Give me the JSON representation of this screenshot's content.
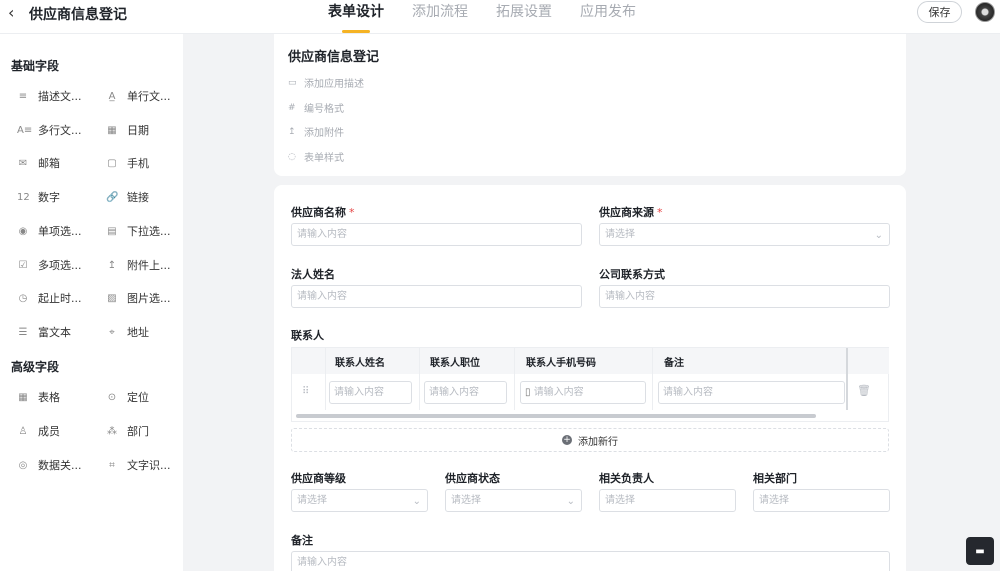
{
  "header": {
    "back_icon": "chevron-left-icon",
    "title": "供应商信息登记",
    "tabs": [
      "表单设计",
      "添加流程",
      "拓展设置",
      "应用发布"
    ],
    "active_tab": 0,
    "save_label": "保存"
  },
  "sidebar": {
    "basic_title": "基础字段",
    "basic_fields": [
      {
        "label": "描述文...",
        "icon": "≡"
      },
      {
        "label": "单行文...",
        "icon": "A̲"
      },
      {
        "label": "多行文...",
        "icon": "A≡"
      },
      {
        "label": "日期",
        "icon": "▦"
      },
      {
        "label": "邮箱",
        "icon": "✉"
      },
      {
        "label": "手机",
        "icon": "▢"
      },
      {
        "label": "数字",
        "icon": "12"
      },
      {
        "label": "链接",
        "icon": "🔗"
      },
      {
        "label": "单项选...",
        "icon": "◉"
      },
      {
        "label": "下拉选...",
        "icon": "▤"
      },
      {
        "label": "多项选...",
        "icon": "☑"
      },
      {
        "label": "附件上...",
        "icon": "↥"
      },
      {
        "label": "起止时...",
        "icon": "◷"
      },
      {
        "label": "图片选...",
        "icon": "▨"
      },
      {
        "label": "富文本",
        "icon": "☰"
      },
      {
        "label": "地址",
        "icon": "⌖"
      }
    ],
    "advanced_title": "高级字段",
    "advanced_fields": [
      {
        "label": "表格",
        "icon": "▦"
      },
      {
        "label": "定位",
        "icon": "⊙"
      },
      {
        "label": "成员",
        "icon": "♙"
      },
      {
        "label": "部门",
        "icon": "⁂"
      },
      {
        "label": "数据关...",
        "icon": "◎"
      },
      {
        "label": "文字识...",
        "icon": "⌗"
      }
    ]
  },
  "form_header": {
    "title": "供应商信息登记",
    "meta": [
      {
        "label": "添加应用描述",
        "icon": "▭"
      },
      {
        "label": "编号格式",
        "icon": "#"
      },
      {
        "label": "添加附件",
        "icon": "↥"
      },
      {
        "label": "表单样式",
        "icon": "◌"
      }
    ]
  },
  "form": {
    "supplier_name": {
      "label": "供应商名称",
      "placeholder": "请输入内容"
    },
    "supplier_source": {
      "label": "供应商来源",
      "placeholder": "请选择"
    },
    "legal_name": {
      "label": "法人姓名",
      "placeholder": "请输入内容"
    },
    "company_contact": {
      "label": "公司联系方式",
      "placeholder": "请输入内容"
    },
    "contacts": {
      "label": "联系人",
      "columns": [
        "联系人姓名",
        "联系人职位",
        "联系人手机号码",
        "备注"
      ],
      "placeholders": [
        "请输入内容",
        "请输入内容",
        "请输入内容",
        "请输入内容"
      ],
      "add_row": "添加新行"
    },
    "supplier_level": {
      "label": "供应商等级",
      "placeholder": "请选择"
    },
    "supplier_status": {
      "label": "供应商状态",
      "placeholder": "请选择"
    },
    "owner": {
      "label": "相关负责人",
      "placeholder": "请选择"
    },
    "department": {
      "label": "相关部门",
      "placeholder": "请选择"
    },
    "remark": {
      "label": "备注",
      "placeholder": "请输入内容"
    }
  },
  "colors": {
    "accent": "#f5b324",
    "required": "#e54545"
  }
}
